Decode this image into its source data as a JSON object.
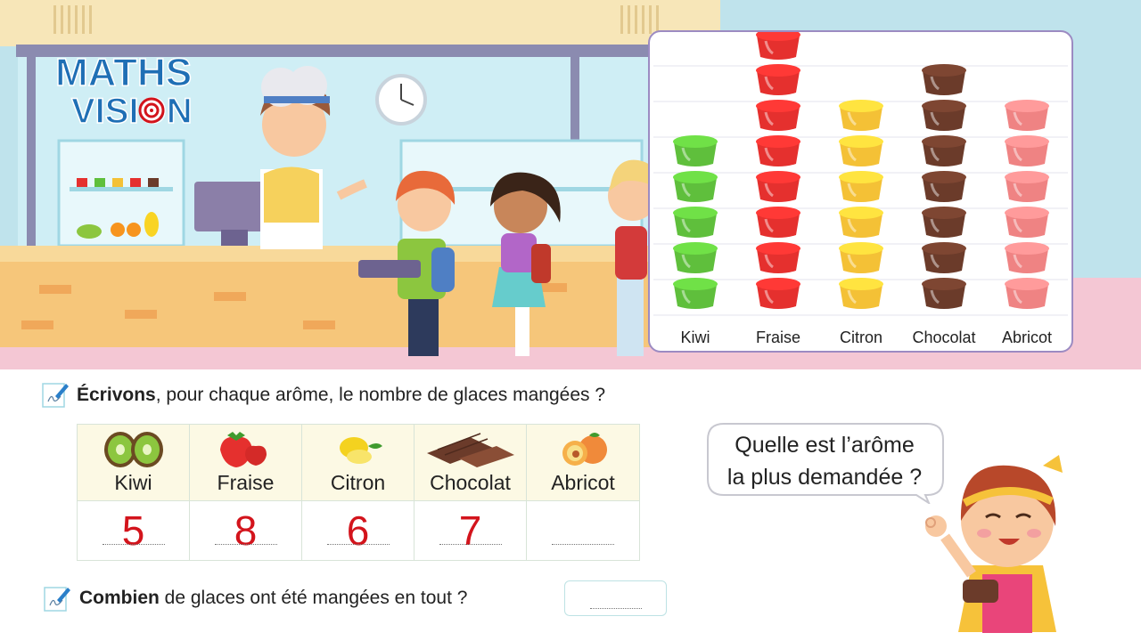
{
  "logo": {
    "line1": "MATHS",
    "line2": "VISION"
  },
  "pictogram": {
    "categories": [
      {
        "label": "Kiwi",
        "count": 5,
        "color": "#5fbf3c"
      },
      {
        "label": "Fraise",
        "count": 8,
        "color": "#e5302e"
      },
      {
        "label": "Citron",
        "count": 6,
        "color": "#f4c136"
      },
      {
        "label": "Chocolat",
        "count": 7,
        "color": "#6b3b2a"
      },
      {
        "label": "Abricot",
        "count": 6,
        "color": "#ef8383"
      }
    ]
  },
  "question1": {
    "bold": "Écrivons",
    "rest": ", pour chaque arôme, le nombre de glaces mangées ?"
  },
  "table": {
    "columns": [
      {
        "name": "Kiwi",
        "value": "5",
        "icon": "kiwi-icon"
      },
      {
        "name": "Fraise",
        "value": "8",
        "icon": "strawberry-icon"
      },
      {
        "name": "Citron",
        "value": "6",
        "icon": "lemon-icon"
      },
      {
        "name": "Chocolat",
        "value": "7",
        "icon": "chocolate-icon"
      },
      {
        "name": "Abricot",
        "value": "",
        "icon": "apricot-icon"
      }
    ]
  },
  "question2": {
    "bold": "Combien",
    "rest": " de glaces ont été mangées en tout ?",
    "answer": ""
  },
  "bubble": {
    "line1": "Quelle est l’arôme",
    "line2": "la plus demandée ?"
  },
  "colors": {
    "accent_red": "#d3141c",
    "logo_blue": "#1f6fb5",
    "frame": "#9c8bc2"
  }
}
